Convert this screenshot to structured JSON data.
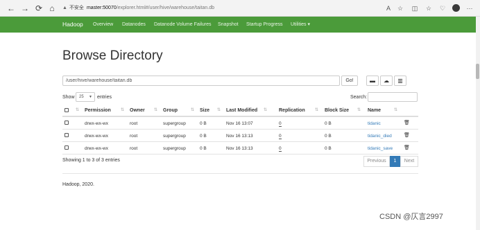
{
  "browser": {
    "insecure_label": "不安全",
    "url_host": "master:50070",
    "url_path": "/explorer.html#/user/hive/warehouse/taitan.db",
    "back_icon": "back-arrow-icon",
    "forward_icon": "forward-arrow-icon",
    "reload_icon": "reload-icon",
    "home_icon": "home-icon",
    "warning_icon": "warning-triangle-icon",
    "read_aloud_label": "A",
    "favorite_icon": "star-icon",
    "split_icon": "split-screen-icon",
    "favorites_icon": "favorites-icon",
    "collections_icon": "collections-icon",
    "heart_icon": "heart-icon",
    "profile_icon": "avatar",
    "menu_label": "···"
  },
  "navbar": {
    "brand": "Hadoop",
    "items": [
      "Overview",
      "Datanodes",
      "Datanode Volume Failures",
      "Snapshot",
      "Startup Progress",
      "Utilities ▾"
    ],
    "color": "#4b9b3a"
  },
  "page": {
    "title": "Browse Directory",
    "path_value": "/user/hive/warehouse/taitan.db",
    "go_label": "Go!",
    "toolbar_icons": [
      "folder-open-icon",
      "upload-icon",
      "clipboard-icon"
    ]
  },
  "controls": {
    "show_label": "Show",
    "page_size": "25",
    "entries_label": "entries",
    "search_label": "Search:"
  },
  "table": {
    "headers": [
      "Permission",
      "Owner",
      "Group",
      "Size",
      "Last Modified",
      "Replication",
      "Block Size",
      "Name"
    ],
    "rows": [
      {
        "permission": "drwx-wx-wx",
        "owner": "root",
        "group": "supergroup",
        "size": "0 B",
        "modified": "Nov 16 13:07",
        "replication": "0",
        "block_size": "0 B",
        "name": "tidanic"
      },
      {
        "permission": "drwx-wx-wx",
        "owner": "root",
        "group": "supergroup",
        "size": "0 B",
        "modified": "Nov 16 13:13",
        "replication": "0",
        "block_size": "0 B",
        "name": "tidanic_died"
      },
      {
        "permission": "drwx-wx-wx",
        "owner": "root",
        "group": "supergroup",
        "size": "0 B",
        "modified": "Nov 16 13:13",
        "replication": "0",
        "block_size": "0 B",
        "name": "tidanic_save"
      }
    ]
  },
  "pagination": {
    "info": "Showing 1 to 3 of 3 entries",
    "previous": "Previous",
    "current": "1",
    "next": "Next",
    "active_color": "#337ab7"
  },
  "footer": {
    "text": "Hadoop, 2020.",
    "watermark": "CSDN @仄言2997"
  }
}
